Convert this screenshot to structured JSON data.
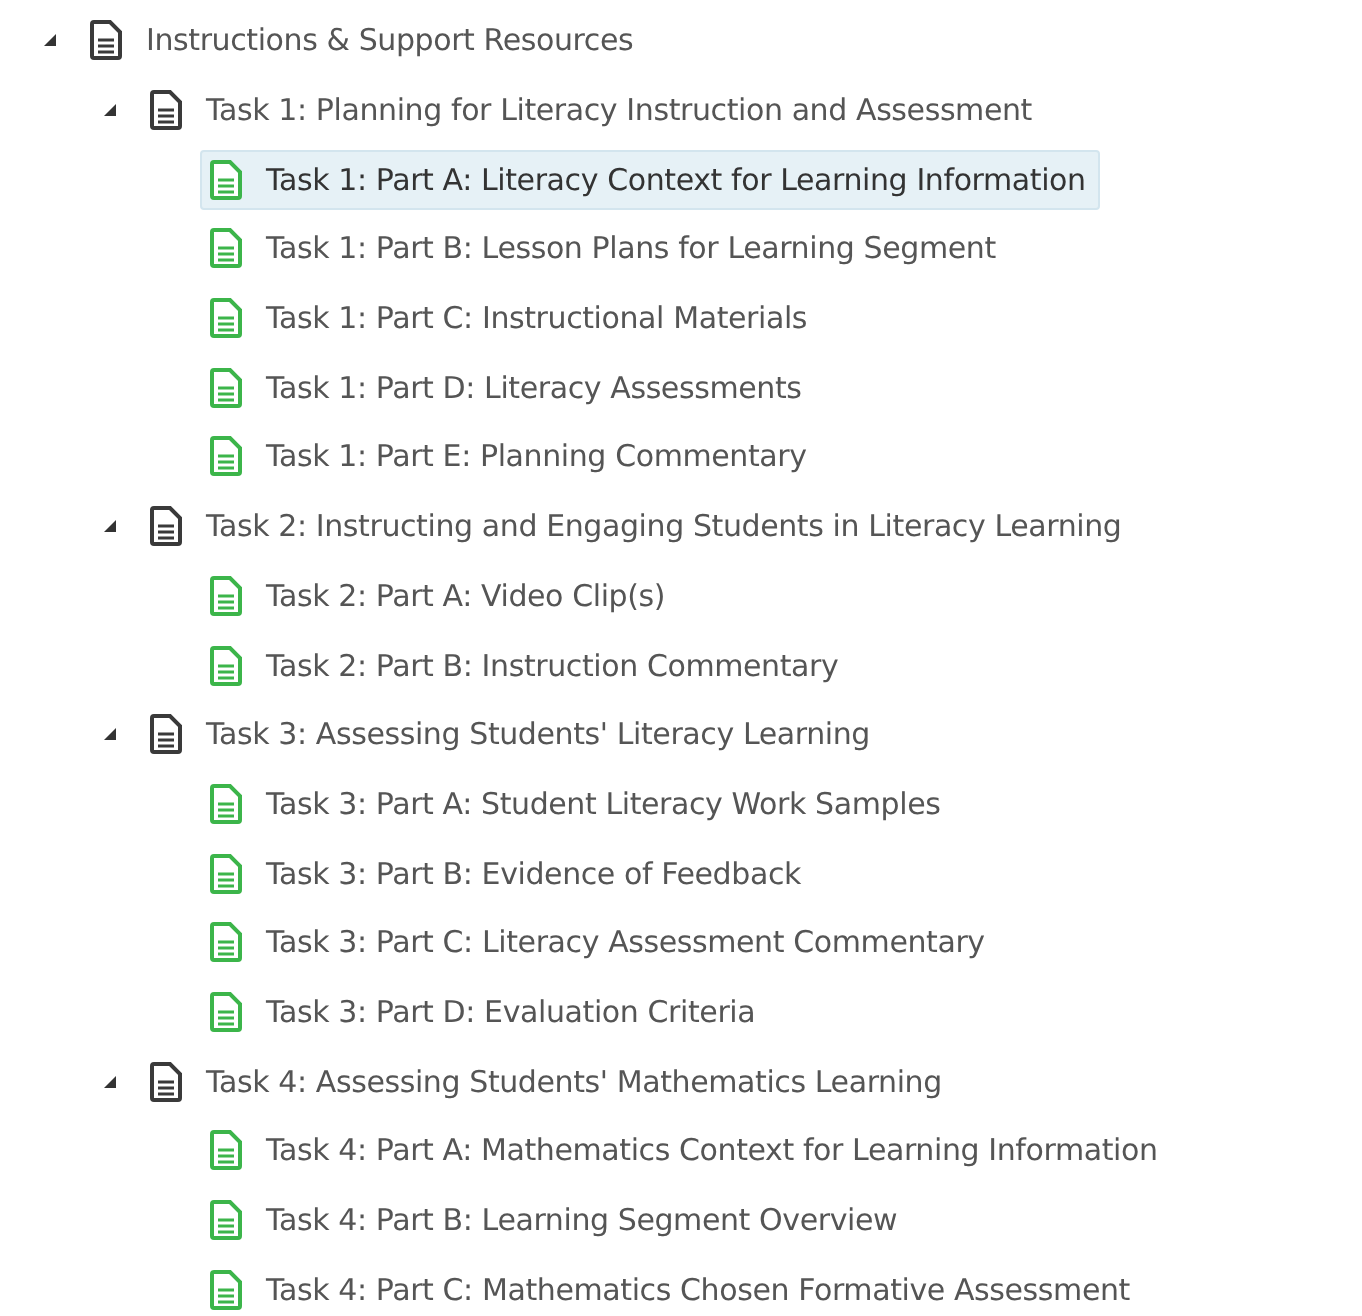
{
  "tree": [
    {
      "label": "Instructions & Support Resources",
      "kind": "section",
      "expanded": true,
      "selected": false,
      "children": [
        {
          "label": "Task 1: Planning for Literacy Instruction and Assessment",
          "kind": "section",
          "expanded": true,
          "selected": false,
          "children": [
            {
              "label": "Task 1: Part A: Literacy Context for Learning Information",
              "kind": "page",
              "selected": true
            },
            {
              "label": "Task 1: Part B: Lesson Plans for Learning Segment",
              "kind": "page",
              "selected": false
            },
            {
              "label": "Task 1: Part C: Instructional Materials",
              "kind": "page",
              "selected": false
            },
            {
              "label": "Task 1: Part D: Literacy Assessments",
              "kind": "page",
              "selected": false
            },
            {
              "label": "Task 1: Part E: Planning Commentary",
              "kind": "page",
              "selected": false
            }
          ]
        },
        {
          "label": "Task 2: Instructing and Engaging Students in Literacy Learning",
          "kind": "section",
          "expanded": true,
          "selected": false,
          "children": [
            {
              "label": "Task 2: Part A: Video Clip(s)",
              "kind": "page",
              "selected": false
            },
            {
              "label": "Task 2: Part B: Instruction Commentary",
              "kind": "page",
              "selected": false
            }
          ]
        },
        {
          "label": "Task 3: Assessing Students' Literacy Learning",
          "kind": "section",
          "expanded": true,
          "selected": false,
          "children": [
            {
              "label": "Task 3: Part A: Student Literacy Work Samples",
              "kind": "page",
              "selected": false
            },
            {
              "label": "Task 3: Part B: Evidence of Feedback",
              "kind": "page",
              "selected": false
            },
            {
              "label": "Task 3: Part C: Literacy Assessment Commentary",
              "kind": "page",
              "selected": false
            },
            {
              "label": "Task 3: Part D: Evaluation Criteria",
              "kind": "page",
              "selected": false
            }
          ]
        },
        {
          "label": "Task 4: Assessing Students' Mathematics Learning",
          "kind": "section",
          "expanded": true,
          "selected": false,
          "children": [
            {
              "label": "Task 4: Part A: Mathematics Context for Learning Information",
              "kind": "page",
              "selected": false
            },
            {
              "label": "Task 4: Part B: Learning Segment Overview",
              "kind": "page",
              "selected": false
            },
            {
              "label": "Task 4: Part C: Mathematics Chosen Formative Assessment",
              "kind": "page",
              "selected": false
            }
          ]
        }
      ]
    }
  ]
}
